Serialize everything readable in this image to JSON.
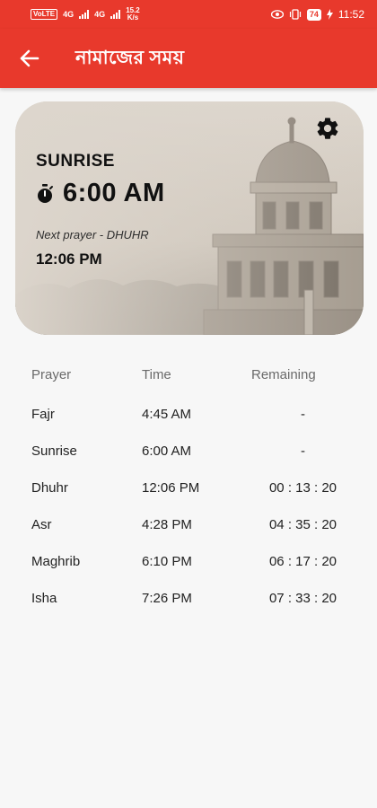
{
  "status_bar": {
    "volte": "VoLTE",
    "net1": "4G",
    "net2": "4G",
    "speed_value": "15.2",
    "speed_unit": "K/s",
    "battery": "74",
    "time": "11:52"
  },
  "app_bar": {
    "title": "নামাজের সময়",
    "back_icon": "arrow-left-icon"
  },
  "hero": {
    "current_prayer": "SUNRISE",
    "current_time": "6:00 AM",
    "next_prayer_text": "Next prayer - DHUHR",
    "next_prayer_time": "12:06 PM",
    "settings_icon": "gear-icon",
    "timer_icon": "stopwatch-icon"
  },
  "table": {
    "headers": {
      "prayer": "Prayer",
      "time": "Time",
      "remaining": "Remaining"
    },
    "rows": [
      {
        "prayer": "Fajr",
        "time": "4:45 AM",
        "remaining": "-"
      },
      {
        "prayer": "Sunrise",
        "time": "6:00 AM",
        "remaining": "-"
      },
      {
        "prayer": "Dhuhr",
        "time": "12:06 PM",
        "remaining": "00 : 13 : 20"
      },
      {
        "prayer": "Asr",
        "time": "4:28 PM",
        "remaining": "04 : 35 : 20"
      },
      {
        "prayer": "Maghrib",
        "time": "6:10 PM",
        "remaining": "06 : 17 : 20"
      },
      {
        "prayer": "Isha",
        "time": "7:26 PM",
        "remaining": "07 : 33 : 20"
      }
    ]
  },
  "colors": {
    "accent": "#e8392c",
    "background": "#f7f7f7"
  }
}
